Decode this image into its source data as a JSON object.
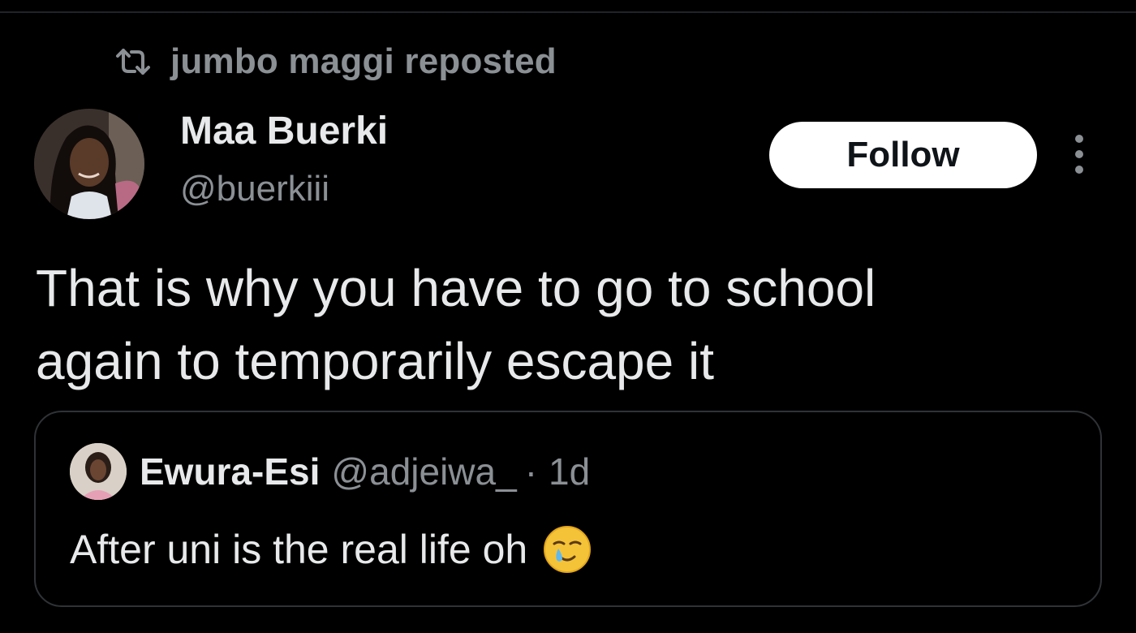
{
  "repost": {
    "text": "jumbo maggi reposted",
    "icon": "repost-icon"
  },
  "author": {
    "display_name": "Maa Buerki",
    "handle": "@buerkiii",
    "avatar_icon": "avatar"
  },
  "actions": {
    "follow_label": "Follow",
    "more_icon": "more-vertical-icon"
  },
  "tweet": {
    "text": "That is why you have to go to school\nagain to temporarily escape it"
  },
  "quoted_tweet": {
    "display_name": "Ewura-Esi",
    "handle": "@adjeiwa_",
    "separator": "·",
    "time": "1d",
    "text": "After uni is the real life oh",
    "emoji": "smiling-face-with-tear-emoji"
  },
  "colors": {
    "background": "#000000",
    "primary_text": "#e7e9ea",
    "secondary_text": "#8b9095",
    "border": "#2f3336",
    "follow_bg": "#ffffff",
    "follow_text": "#0f1419"
  }
}
